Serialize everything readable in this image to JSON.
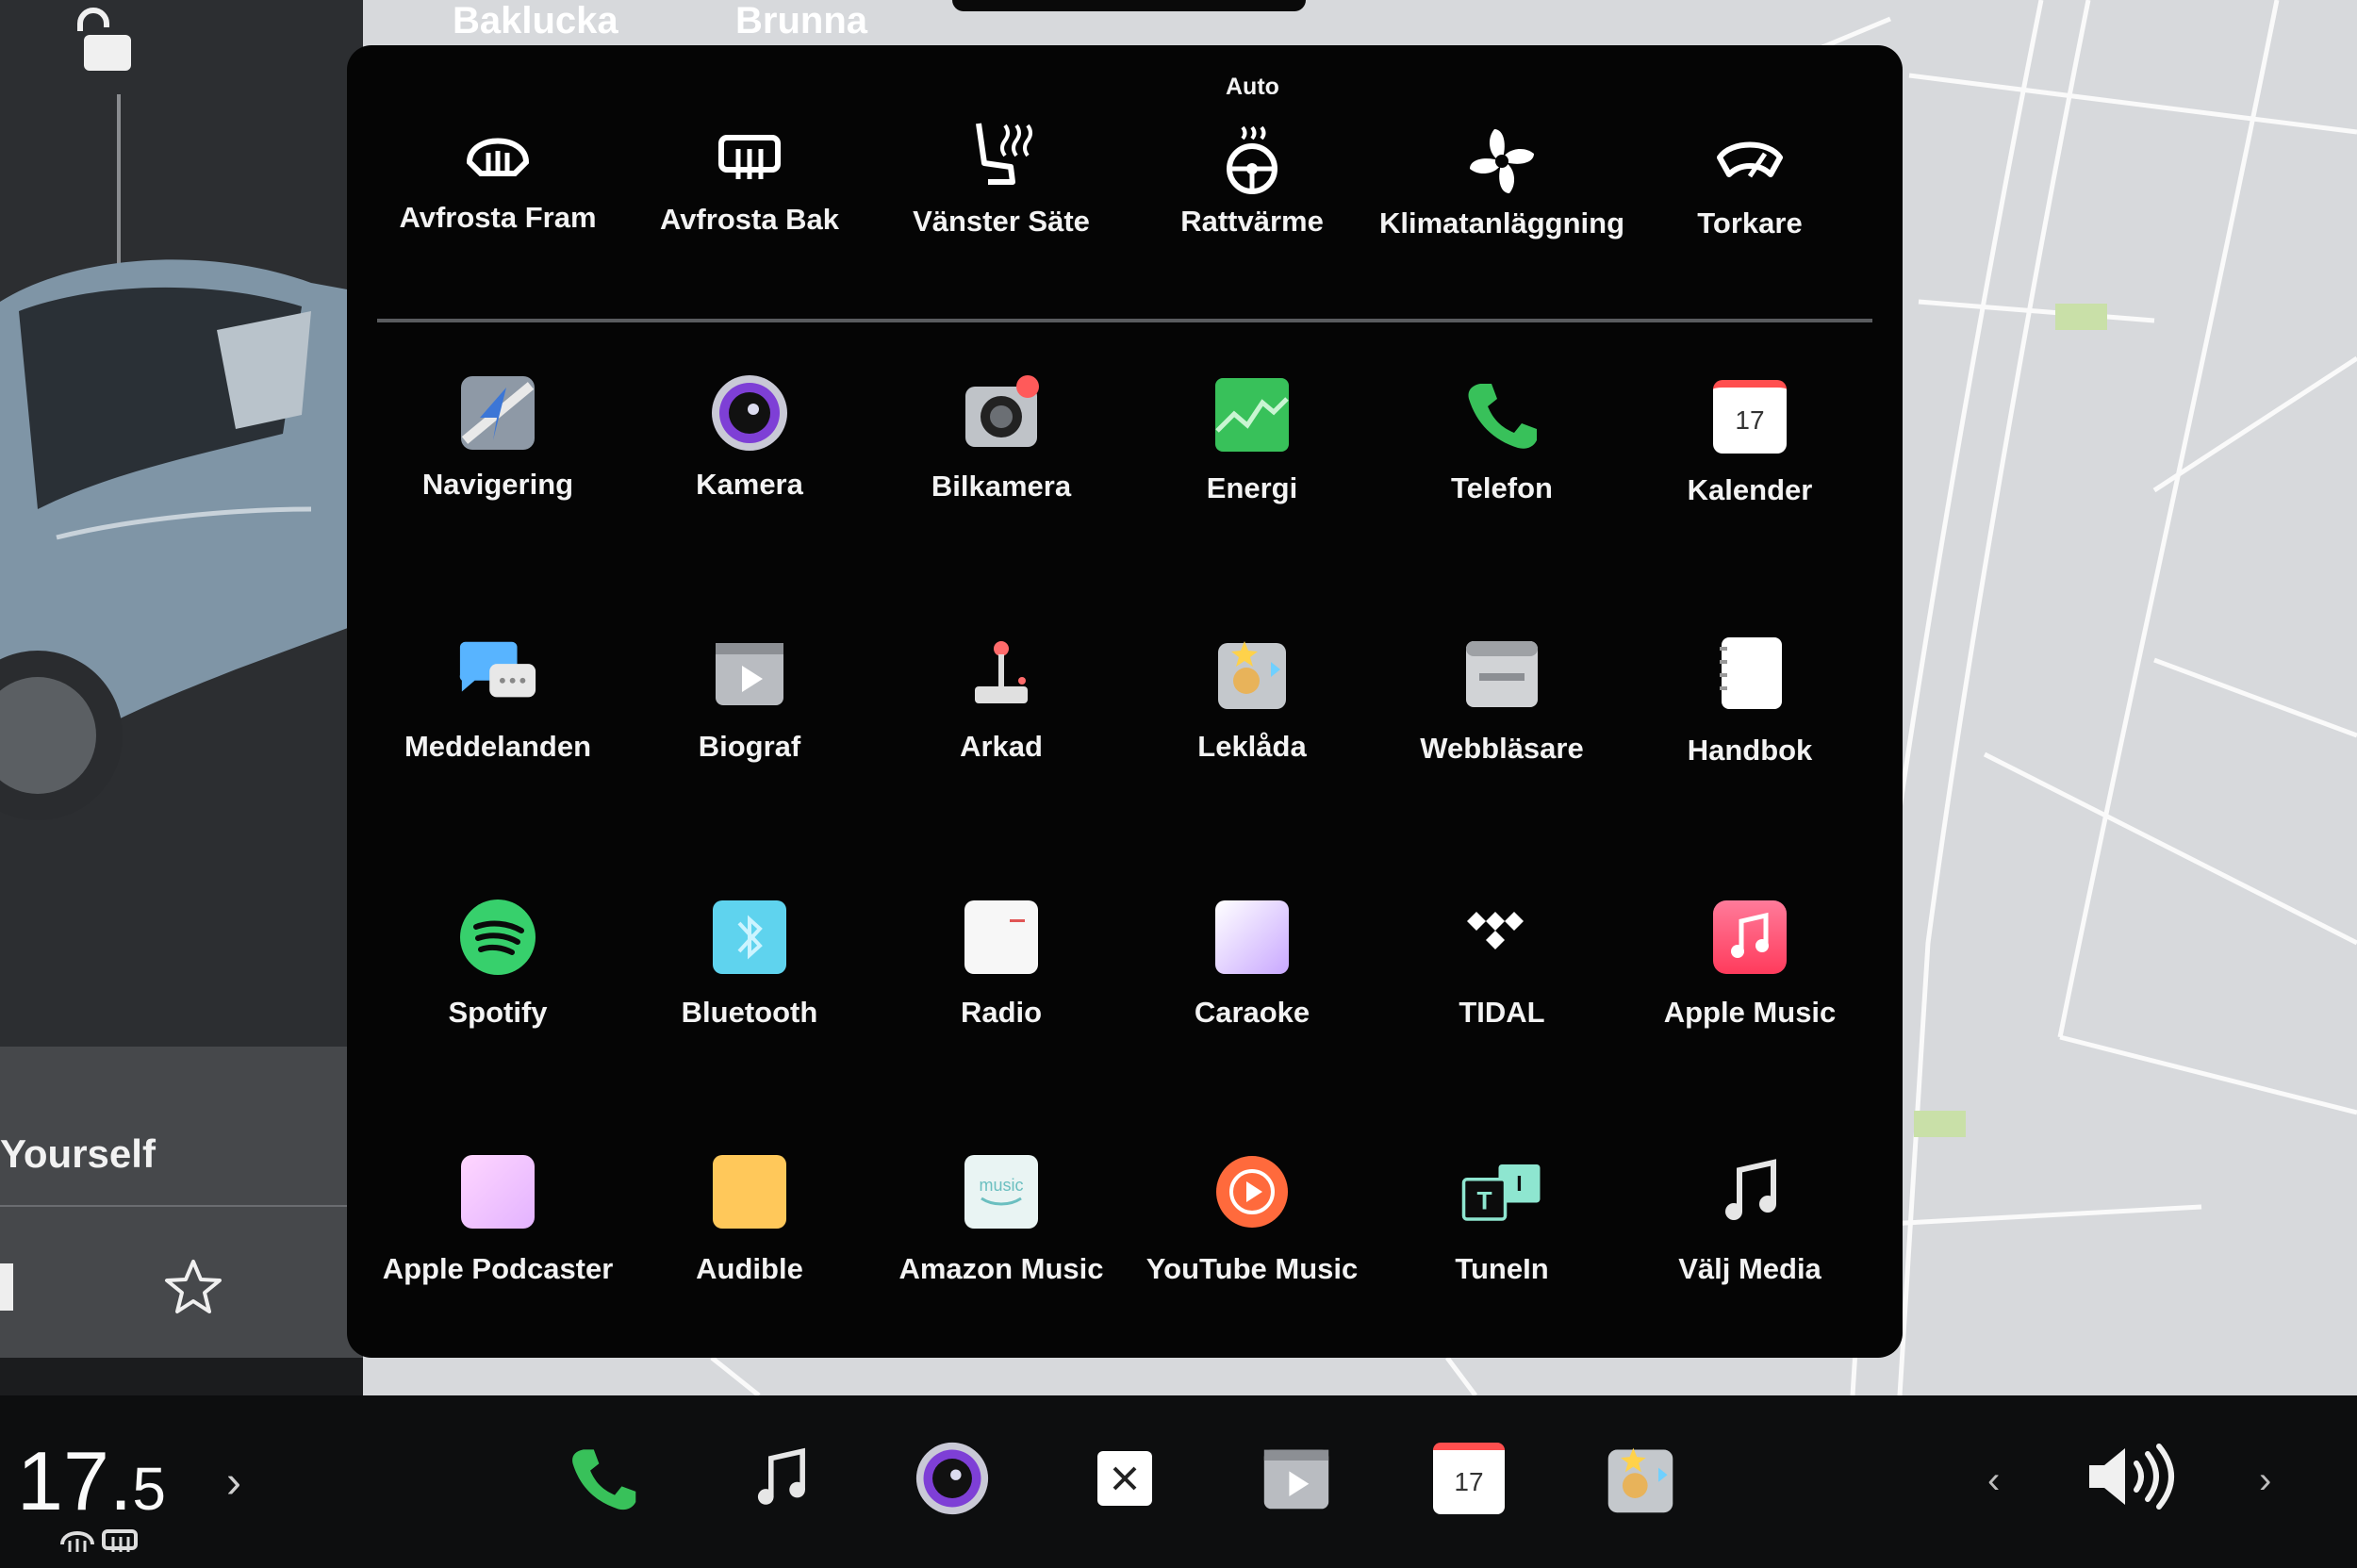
{
  "left_panel": {
    "promo_text": "Yourself"
  },
  "map_labels": {
    "street_1": "Bakluckа",
    "street_2": "Brunna"
  },
  "climate": {
    "auto_label": "Auto",
    "items": [
      {
        "label": "Avfrosta Fram",
        "icon": "front-defrost-icon"
      },
      {
        "label": "Avfrosta Bak",
        "icon": "rear-defrost-icon"
      },
      {
        "label": "Vänster Säte",
        "icon": "seat-heater-icon"
      },
      {
        "label": "Rattvärme",
        "icon": "steering-heat-icon"
      },
      {
        "label": "Klimatanläggning",
        "icon": "fan-icon"
      },
      {
        "label": "Torkare",
        "icon": "wiper-icon"
      }
    ]
  },
  "apps": [
    {
      "label": "Navigering",
      "icon": "navigation-icon"
    },
    {
      "label": "Kamera",
      "icon": "camera-icon"
    },
    {
      "label": "Bilkamera",
      "icon": "dashcam-icon"
    },
    {
      "label": "Energi",
      "icon": "energy-icon"
    },
    {
      "label": "Telefon",
      "icon": "phone-icon"
    },
    {
      "label": "Kalender",
      "icon": "calendar-icon"
    },
    {
      "label": "Meddelanden",
      "icon": "messages-icon"
    },
    {
      "label": "Biograf",
      "icon": "theater-icon"
    },
    {
      "label": "Arkad",
      "icon": "arcade-icon"
    },
    {
      "label": "Leklåda",
      "icon": "toybox-icon"
    },
    {
      "label": "Webbläsare",
      "icon": "browser-icon"
    },
    {
      "label": "Handbok",
      "icon": "manual-icon"
    },
    {
      "label": "Spotify",
      "icon": "spotify-icon"
    },
    {
      "label": "Bluetooth",
      "icon": "bluetooth-icon"
    },
    {
      "label": "Radio",
      "icon": "radio-icon"
    },
    {
      "label": "Caraoke",
      "icon": "caraoke-icon"
    },
    {
      "label": "TIDAL",
      "icon": "tidal-icon"
    },
    {
      "label": "Apple Music",
      "icon": "apple-music-icon"
    },
    {
      "label": "Apple Podcaster",
      "icon": "podcasts-icon"
    },
    {
      "label": "Audible",
      "icon": "audible-icon"
    },
    {
      "label": "Amazon Music",
      "icon": "amazon-music-icon"
    },
    {
      "label": "YouTube Music",
      "icon": "youtube-music-icon"
    },
    {
      "label": "TuneIn",
      "icon": "tunein-icon"
    },
    {
      "label": "Välj Media",
      "icon": "media-icon"
    }
  ],
  "calendar_day": "17",
  "bottom_bar": {
    "temp_main": "17.",
    "temp_decimal": "5",
    "chevron": "›",
    "vol_prev": "‹",
    "vol_next": "›",
    "dock_icons": [
      "phone-icon",
      "music-icon",
      "camera-icon",
      "close-icon",
      "theater-icon",
      "calendar-icon",
      "toybox-icon"
    ]
  },
  "colors": {
    "launcher_bg": "#050505",
    "map_bg": "#d7d9dc",
    "accent_green": "#38c15a"
  }
}
